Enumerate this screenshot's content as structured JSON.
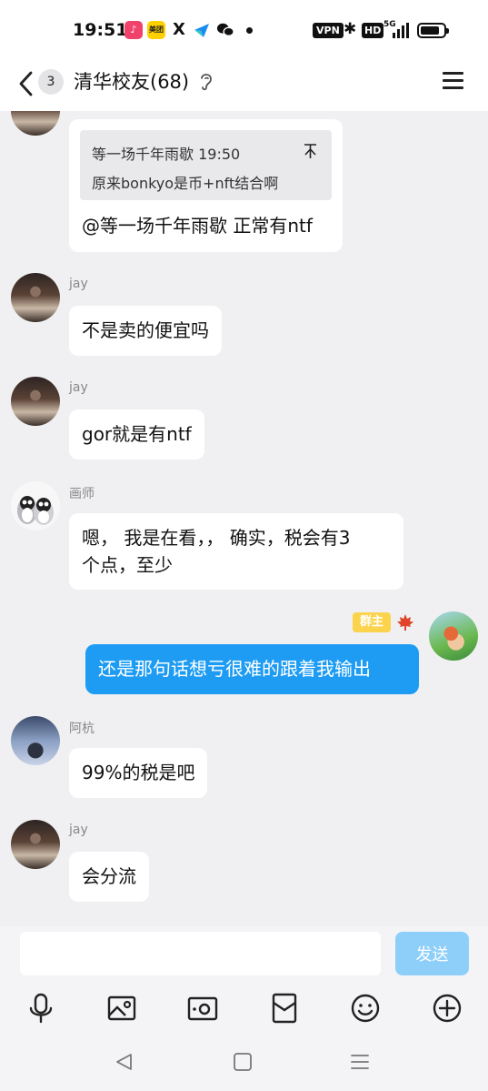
{
  "status_bar": {
    "time": "19:51",
    "app_icons": [
      {
        "name": "music-app-icon",
        "color": "#f1426c",
        "glyph": "♪"
      },
      {
        "name": "meituan-app-icon",
        "color": "#ffd100",
        "glyph": "美团"
      },
      {
        "name": "x-app-icon",
        "color": "#ffffff",
        "glyph": "𝕏"
      },
      {
        "name": "feishu-app-icon",
        "color": "#ffffff",
        "glyph": "◢"
      },
      {
        "name": "wechat-app-icon",
        "color": "#ffffff",
        "glyph": "◉"
      }
    ],
    "vpn": "VPN",
    "hd": "HD",
    "network": "5G"
  },
  "header": {
    "unread_count": "3",
    "title": "清华校友(68)"
  },
  "messages": [
    {
      "sender": "",
      "quote_author_time": "等一场千年雨歇 19:50",
      "quote_text": "原来bonkyo是币+nft结合啊",
      "text": "@等一场千年雨歇 正常有ntf"
    },
    {
      "sender": "jay",
      "text": "不是卖的便宜吗"
    },
    {
      "sender": "jay",
      "text": "gor就是有ntf"
    },
    {
      "sender": "画师",
      "text_line1": "嗯， 我是在看，， 确实，税会有3",
      "text_line2": "个点，至少"
    },
    {
      "sender": "me",
      "tag": "群主",
      "text": "还是那句话想亏很难的跟着我输出"
    },
    {
      "sender": "阿杭",
      "text": "99%的税是吧"
    },
    {
      "sender": "jay",
      "text": "会分流"
    }
  ],
  "input": {
    "placeholder": "",
    "send_label": "发送"
  },
  "colors": {
    "accent": "#1e9cf3",
    "send_disabled": "#8ecffa",
    "owner_tag": "#fcd34d"
  },
  "toolbar_icons": [
    "microphone-icon",
    "image-icon",
    "camera-icon",
    "red-packet-icon",
    "emoji-icon",
    "plus-icon"
  ]
}
